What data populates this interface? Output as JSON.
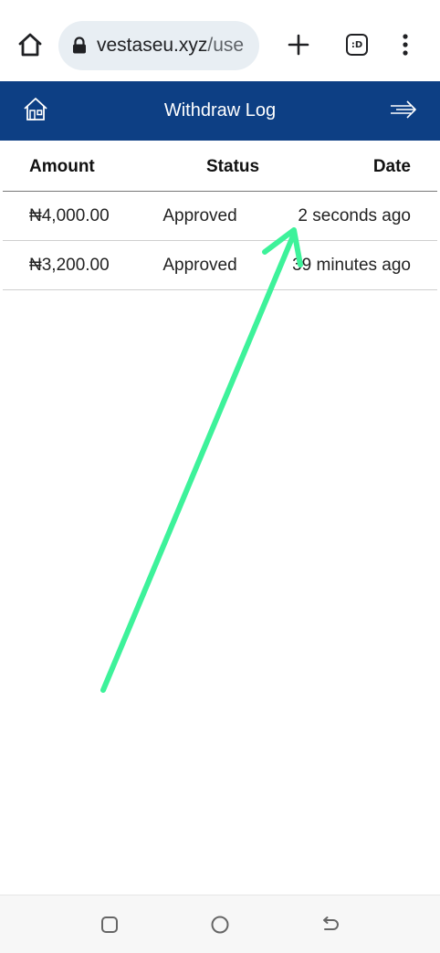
{
  "browser": {
    "url_host": "vestaseu.xyz",
    "url_path": "/use",
    "tabs_badge": ":D",
    "icons": [
      "home-icon",
      "lock-icon",
      "plus-icon",
      "tabs-icon",
      "more-vert-icon"
    ]
  },
  "header": {
    "title": "Withdraw Log",
    "background": "#0d3f84",
    "icons": [
      "house-icon",
      "logout-arrow-icon"
    ]
  },
  "table": {
    "columns": [
      "Amount",
      "Status",
      "Date"
    ],
    "rows": [
      {
        "amount": "₦4,000.00",
        "status": "Approved",
        "date": "2 seconds ago"
      },
      {
        "amount": "₦3,200.00",
        "status": "Approved",
        "date": "39 minutes ago"
      }
    ]
  },
  "annotation": {
    "type": "arrow",
    "color": "#3df29a"
  },
  "navbar": {
    "icons": [
      "recents-icon",
      "home-circle-icon",
      "back-icon"
    ]
  }
}
